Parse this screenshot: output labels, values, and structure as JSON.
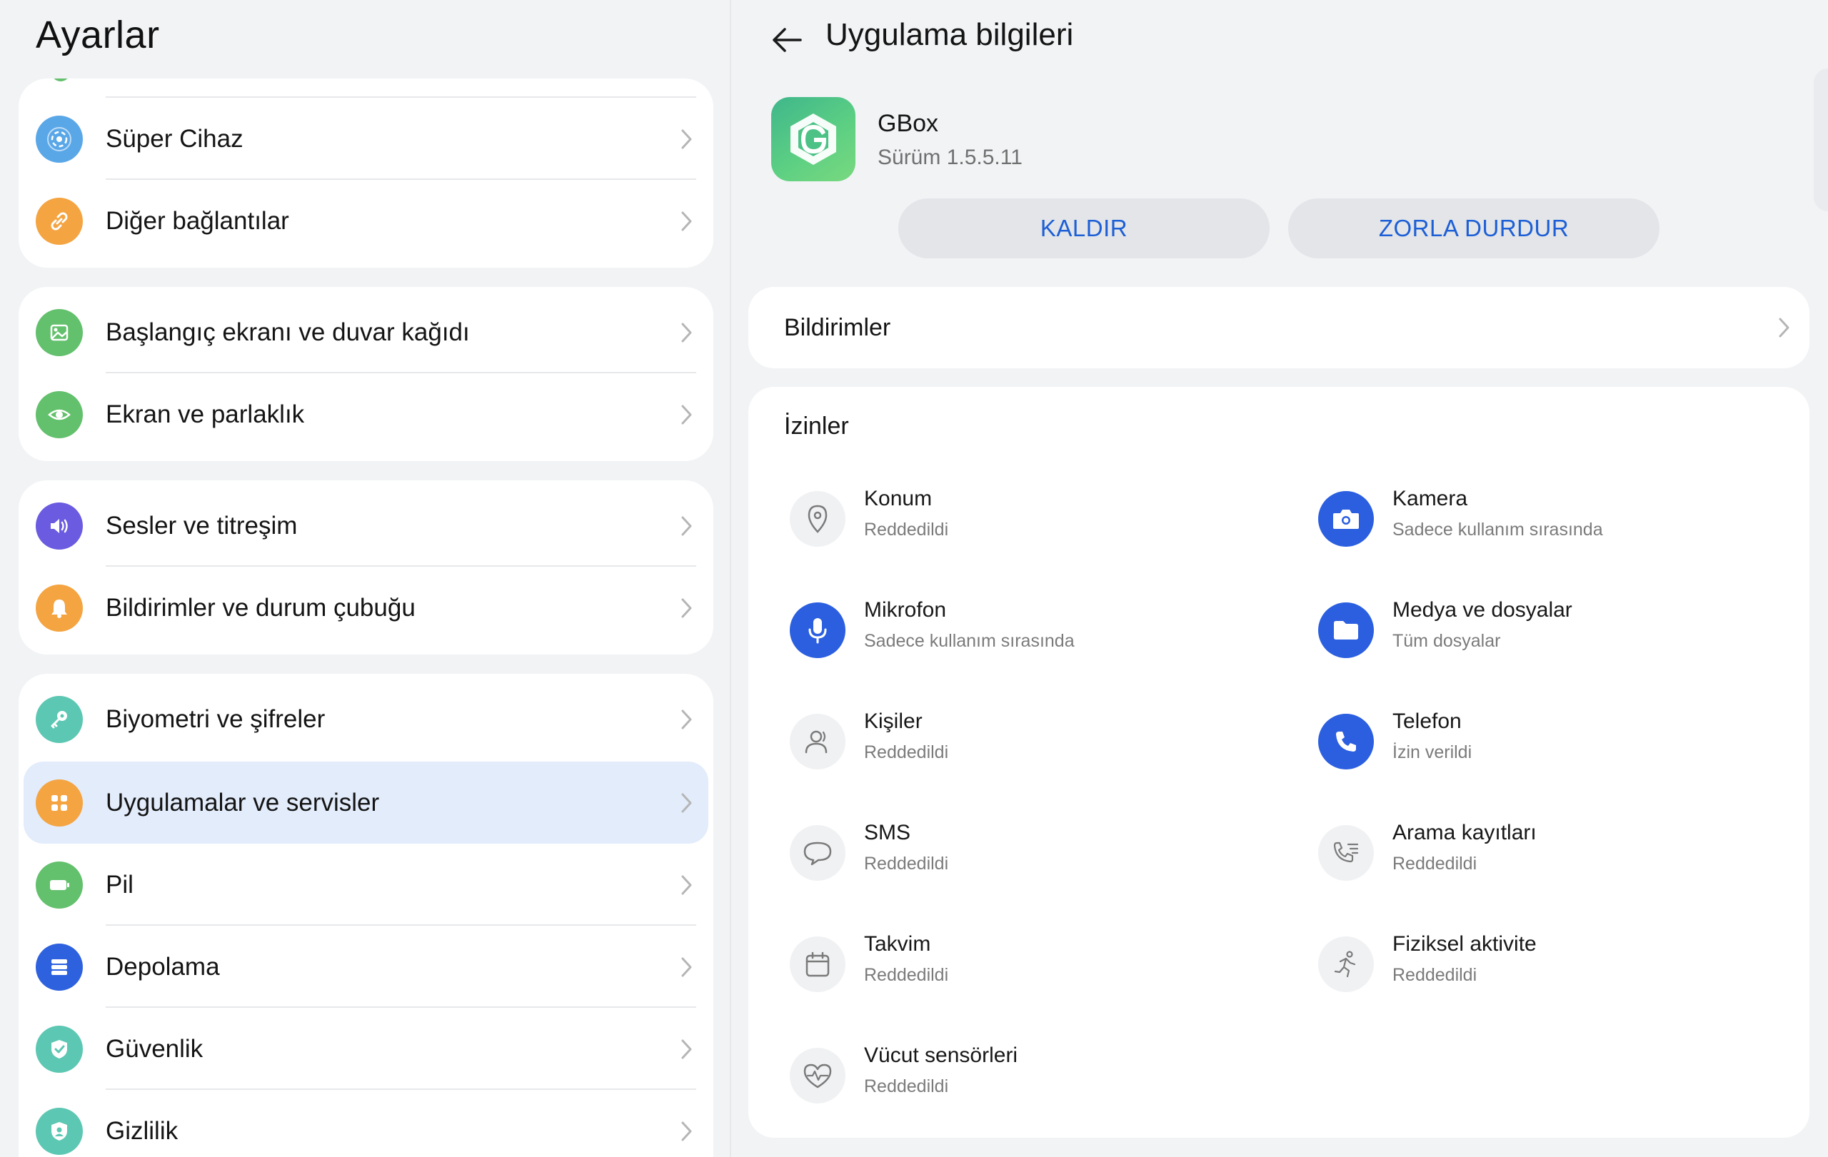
{
  "left": {
    "title": "Ayarlar",
    "groups": [
      {
        "items": [
          {
            "label": "Süper Cihaz",
            "icon": "super-device-icon",
            "color": "#5aa7e8"
          },
          {
            "label": "Diğer bağlantılar",
            "icon": "link-icon",
            "color": "#f4a441"
          }
        ]
      },
      {
        "items": [
          {
            "label": "Başlangıç ekranı ve duvar kağıdı",
            "icon": "wallpaper-icon",
            "color": "#63c06c"
          },
          {
            "label": "Ekran ve parlaklık",
            "icon": "eye-icon",
            "color": "#63c06c"
          }
        ]
      },
      {
        "items": [
          {
            "label": "Sesler ve titreşim",
            "icon": "speaker-icon",
            "color": "#6a5be0"
          },
          {
            "label": "Bildirimler ve durum çubuğu",
            "icon": "bell-icon",
            "color": "#f4a441"
          }
        ]
      },
      {
        "items": [
          {
            "label": "Biyometri ve şifreler",
            "icon": "key-icon",
            "color": "#5cc7b2"
          },
          {
            "label": "Uygulamalar ve servisler",
            "icon": "apps-icon",
            "color": "#f4a441",
            "selected": true
          },
          {
            "label": "Pil",
            "icon": "battery-icon",
            "color": "#63c06c"
          },
          {
            "label": "Depolama",
            "icon": "storage-icon",
            "color": "#2d61de"
          },
          {
            "label": "Güvenlik",
            "icon": "shield-check-icon",
            "color": "#5cc7b2"
          },
          {
            "label": "Gizlilik",
            "icon": "privacy-shield-icon",
            "color": "#5cc7b2"
          }
        ]
      }
    ]
  },
  "right": {
    "title": "Uygulama bilgileri",
    "app": {
      "name": "GBox",
      "version": "Sürüm 1.5.5.11"
    },
    "buttons": {
      "uninstall": "KALDIR",
      "force_stop": "ZORLA DURDUR"
    },
    "notifications_label": "Bildirimler",
    "permissions_title": "İzinler",
    "permissions": [
      {
        "name": "Konum",
        "status": "Reddedildi",
        "icon": "location-pin-icon",
        "granted": false
      },
      {
        "name": "Kamera",
        "status": "Sadece kullanım sırasında",
        "icon": "camera-icon",
        "granted": true
      },
      {
        "name": "Mikrofon",
        "status": "Sadece kullanım sırasında",
        "icon": "microphone-icon",
        "granted": true
      },
      {
        "name": "Medya ve dosyalar",
        "status": "Tüm dosyalar",
        "icon": "folder-icon",
        "granted": true
      },
      {
        "name": "Kişiler",
        "status": "Reddedildi",
        "icon": "contacts-icon",
        "granted": false
      },
      {
        "name": "Telefon",
        "status": "İzin verildi",
        "icon": "phone-icon",
        "granted": true
      },
      {
        "name": "SMS",
        "status": "Reddedildi",
        "icon": "sms-bubble-icon",
        "granted": false
      },
      {
        "name": "Arama kayıtları",
        "status": "Reddedildi",
        "icon": "call-log-icon",
        "granted": false
      },
      {
        "name": "Takvim",
        "status": "Reddedildi",
        "icon": "calendar-icon",
        "granted": false
      },
      {
        "name": "Fiziksel aktivite",
        "status": "Reddedildi",
        "icon": "running-icon",
        "granted": false
      },
      {
        "name": "Vücut sensörleri",
        "status": "Reddedildi",
        "icon": "heart-rate-icon",
        "granted": false
      }
    ]
  },
  "colors": {
    "accent": "#1d5fd6",
    "granted_icon_bg": "#2b5fe0",
    "selected_row_bg": "#e3ecfb",
    "page_bg": "#f1f3f5"
  }
}
